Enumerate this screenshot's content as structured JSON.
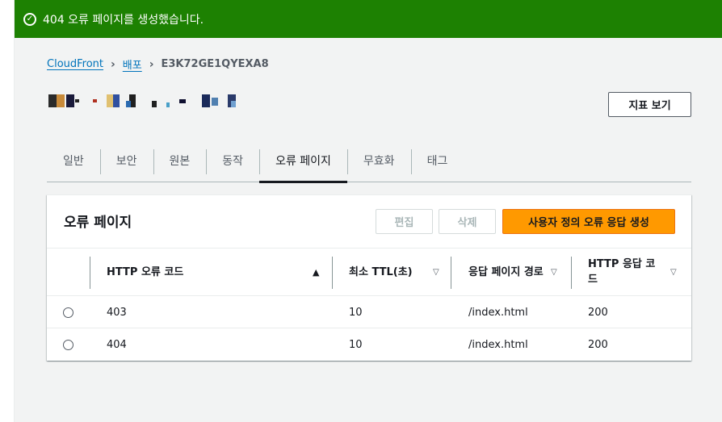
{
  "flash": {
    "message": "404 오류 페이지를 생성했습니다.",
    "icon": "success-check-icon",
    "color": "#1d8102"
  },
  "breadcrumb": {
    "items": [
      "CloudFront",
      "배포",
      "E3K72GE1QYEXA8"
    ]
  },
  "header": {
    "metrics_button": "지표 보기"
  },
  "tabs": [
    "일반",
    "보안",
    "원본",
    "동작",
    "오류 페이지",
    "무효화",
    "태그"
  ],
  "active_tab": "오류 페이지",
  "panel": {
    "title": "오류 페이지",
    "edit_button": "편집",
    "delete_button": "삭제",
    "create_button": "사용자 정의 오류 응답 생성"
  },
  "table": {
    "columns": [
      "HTTP 오류 코드",
      "최소 TTL(초)",
      "응답 페이지 경로",
      "HTTP 응답 코드"
    ],
    "rows": [
      {
        "code": "403",
        "ttl": "10",
        "path": "/index.html",
        "response": "200"
      },
      {
        "code": "404",
        "ttl": "10",
        "path": "/index.html",
        "response": "200"
      }
    ]
  },
  "colors": {
    "accent": "#ff9900",
    "link": "#0073bb",
    "success": "#1d8102"
  }
}
